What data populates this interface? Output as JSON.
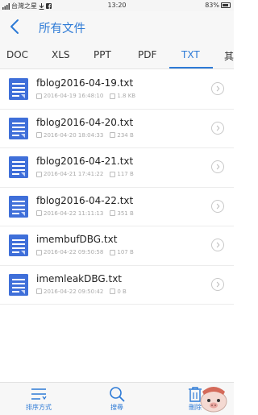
{
  "status_bar": {
    "carrier": "台灣之星",
    "time": "13:20",
    "battery": "83%"
  },
  "header": {
    "title": "所有文件"
  },
  "tabs": [
    {
      "label": "DOC"
    },
    {
      "label": "XLS"
    },
    {
      "label": "PPT"
    },
    {
      "label": "PDF"
    },
    {
      "label": "TXT"
    },
    {
      "label": "其"
    }
  ],
  "active_tab": "TXT",
  "files": [
    {
      "name": "fblog2016-04-19.txt",
      "date": "2016-04-19 16:48:10",
      "size": "1.8 KB"
    },
    {
      "name": "fblog2016-04-20.txt",
      "date": "2016-04-20 18:04:33",
      "size": "234 B"
    },
    {
      "name": "fblog2016-04-21.txt",
      "date": "2016-04-21 17:41:22",
      "size": "117 B"
    },
    {
      "name": "fblog2016-04-22.txt",
      "date": "2016-04-22 11:11:13",
      "size": "351 B"
    },
    {
      "name": "imembufDBG.txt",
      "date": "2016-04-22 09:50:58",
      "size": "107 B"
    },
    {
      "name": "imemleakDBG.txt",
      "date": "2016-04-22 09:50:42",
      "size": "0 B"
    }
  ],
  "bottom_bar": {
    "sort_label": "排序方式",
    "search_label": "搜尋",
    "delete_label": "刪除"
  },
  "colors": {
    "accent": "#2d7ad6",
    "file_icon": "#3f6fd9"
  }
}
